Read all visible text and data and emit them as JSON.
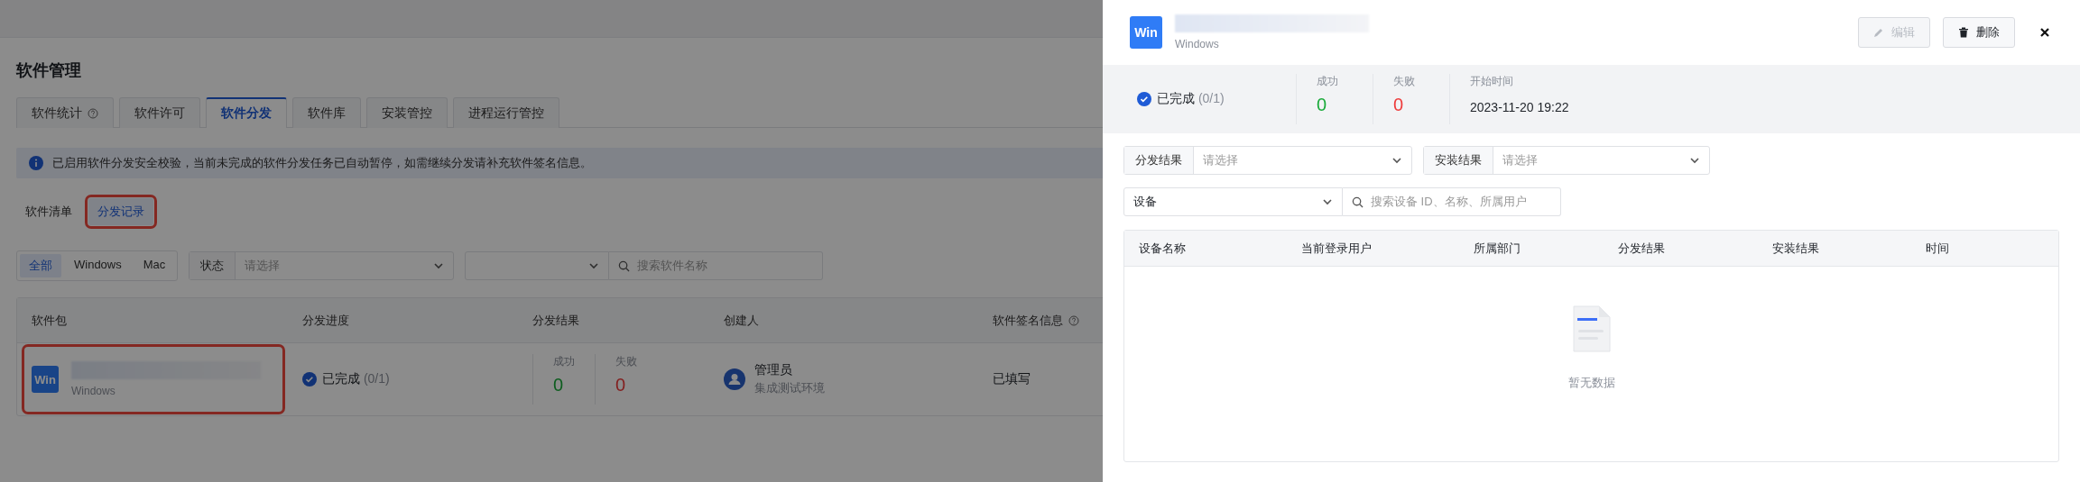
{
  "page": {
    "title": "软件管理",
    "tabs": [
      {
        "label": "软件统计",
        "help": true,
        "selected": false
      },
      {
        "label": "软件许可",
        "help": false,
        "selected": false
      },
      {
        "label": "软件分发",
        "help": false,
        "selected": true
      },
      {
        "label": "软件库",
        "help": false,
        "selected": false
      },
      {
        "label": "安装管控",
        "help": false,
        "selected": false
      },
      {
        "label": "进程运行管控",
        "help": false,
        "selected": false
      }
    ],
    "notice": "已启用软件分发安全校验，当前未完成的软件分发任务已自动暂停，如需继续分发请补充软件签名信息。",
    "subtabs": [
      {
        "label": "软件清单",
        "selected": false,
        "highlighted": false
      },
      {
        "label": "分发记录",
        "selected": true,
        "highlighted": true
      }
    ],
    "platforms": [
      {
        "label": "全部",
        "selected": true
      },
      {
        "label": "Windows",
        "selected": false
      },
      {
        "label": "Mac",
        "selected": false
      }
    ],
    "status_filter": {
      "label": "状态",
      "placeholder": "请选择"
    },
    "search": {
      "placeholder": "搜索软件名称"
    },
    "table": {
      "columns": [
        {
          "label": "软件包",
          "help": false
        },
        {
          "label": "分发进度",
          "help": false
        },
        {
          "label": "分发结果",
          "help": false
        },
        {
          "label": "创建人",
          "help": false
        },
        {
          "label": "软件签名信息",
          "help": true
        }
      ],
      "rows": [
        {
          "badge": "Win",
          "platform": "Windows",
          "highlighted": true,
          "progress": "已完成",
          "progress_count": "(0/1)",
          "success_label": "成功",
          "success": "0",
          "fail_label": "失败",
          "fail": "0",
          "creator": "管理员",
          "creator_group": "集成测试环境",
          "signature": "已填写"
        }
      ]
    }
  },
  "drawer": {
    "badge": "Win",
    "platform": "Windows",
    "buttons": [
      {
        "label": "编辑",
        "kind": "edit",
        "disabled": true
      },
      {
        "label": "删除",
        "kind": "delete",
        "disabled": false
      }
    ],
    "status": "已完成",
    "status_count": "(0/1)",
    "stats": [
      {
        "kind": "success",
        "label": "成功",
        "value": "0"
      },
      {
        "kind": "fail",
        "label": "失败",
        "value": "0"
      },
      {
        "kind": "time",
        "label": "开始时间",
        "value": "2023-11-20 19:22"
      }
    ],
    "filters": [
      {
        "label": "分发结果",
        "placeholder": "请选择"
      },
      {
        "label": "安装结果",
        "placeholder": "请选择"
      }
    ],
    "device_select": "设备",
    "device_search": {
      "placeholder": "搜索设备 ID、名称、所属用户"
    },
    "columns": [
      "设备名称",
      "当前登录用户",
      "所属部门",
      "分发结果",
      "安装结果",
      "时间"
    ],
    "empty": "暂无数据"
  }
}
